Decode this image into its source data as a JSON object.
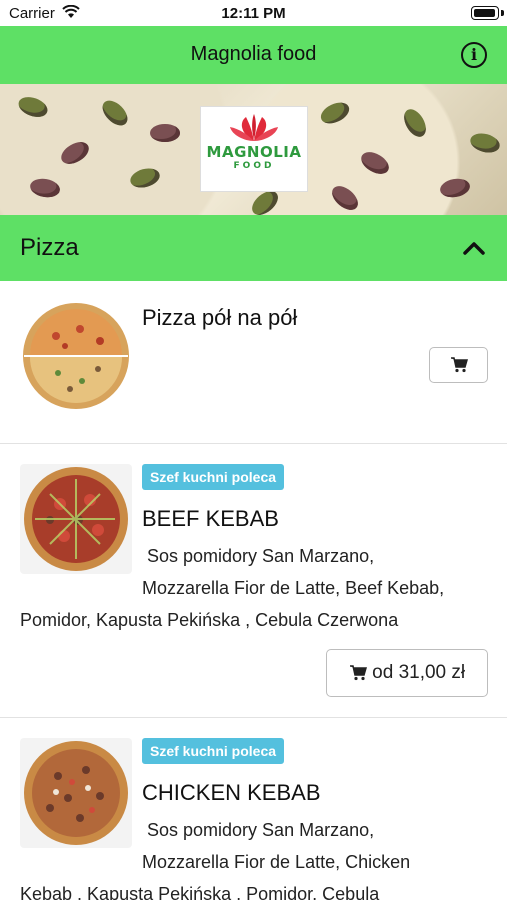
{
  "status_bar": {
    "carrier": "Carrier",
    "time": "12:11 PM"
  },
  "nav": {
    "title": "Magnolia food"
  },
  "banner": {
    "logo_text": "MAGNOLIA",
    "logo_sub": "FOOD"
  },
  "section": {
    "title": "Pizza"
  },
  "products": [
    {
      "name": "Pizza pół na pół"
    },
    {
      "badge": "Szef kuchni poleca",
      "name": "BEEF KEBAB",
      "desc_1": " Sos pomidory San Marzano,",
      "desc_2": "Mozzarella Fior de Latte, Beef Kebab,",
      "desc_3": "Pomidor, Kapusta Pekińska , Cebula Czerwona",
      "price": "od 31,00 zł"
    },
    {
      "badge": "Szef kuchni poleca",
      "name": "CHICKEN KEBAB",
      "desc_1": " Sos pomidory San Marzano,",
      "desc_2": "Mozzarella Fior de Latte, Chicken",
      "desc_3": "Kebab , Kapusta Pekińska , Pomidor, Cebula"
    }
  ],
  "colors": {
    "accent": "#5ee065",
    "badge": "#54c0de"
  }
}
